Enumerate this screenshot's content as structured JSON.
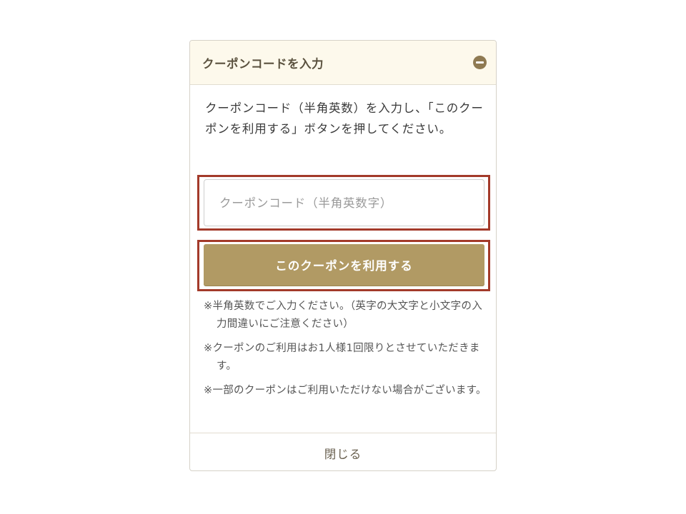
{
  "panel": {
    "title": "クーポンコードを入力",
    "collapse_icon": "minus-circle-icon",
    "description": "クーポンコード（半角英数）を入力し、「このクーポンを利用する」ボタンを押してください。"
  },
  "coupon_input": {
    "value": "",
    "placeholder": "クーポンコード（半角英数字）"
  },
  "apply_button": {
    "label": "このクーポンを利用する"
  },
  "notes": [
    "※半角英数でご入力ください。（英字の大文字と小文字の入力間違いにご注意ください）",
    "※クーポンのご利用はお1人様1回限りとさせていただきます。",
    "※一部のクーポンはご利用いただけない場合がございます。"
  ],
  "footer": {
    "close_label": "閉じる"
  },
  "colors": {
    "header_bg": "#fdf9ec",
    "accent_button": "#b19a64",
    "highlight_outline": "#a33a2a",
    "icon": "#8f7a52"
  }
}
